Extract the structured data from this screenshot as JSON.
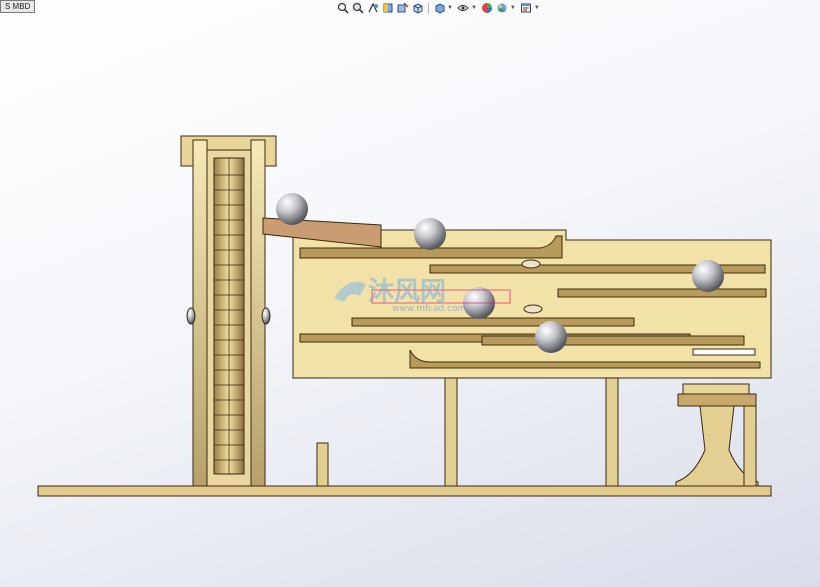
{
  "tab": {
    "label": "S MBD"
  },
  "toolbar": {
    "items": [
      {
        "icon": "zoom-to-fit-icon"
      },
      {
        "icon": "zoom-area-icon"
      },
      {
        "icon": "previous-view-icon"
      },
      {
        "icon": "section-view-icon"
      },
      {
        "icon": "dynamic-annotation-icon"
      },
      {
        "icon": "view-orientation-icon"
      },
      {
        "icon": "display-style-icon"
      },
      {
        "icon": "hide-show-items-icon"
      },
      {
        "icon": "edit-appearance-icon"
      },
      {
        "icon": "apply-scene-icon"
      },
      {
        "icon": "view-settings-icon"
      }
    ]
  },
  "watermark": {
    "brand": "沐风网",
    "url": "www.mfcad.com"
  },
  "colors": {
    "part": "#f3e2a8",
    "edge": "#3a2a10",
    "ball": "#c4c6cc",
    "base": "#e2c98c",
    "accent": "#e0185f"
  }
}
